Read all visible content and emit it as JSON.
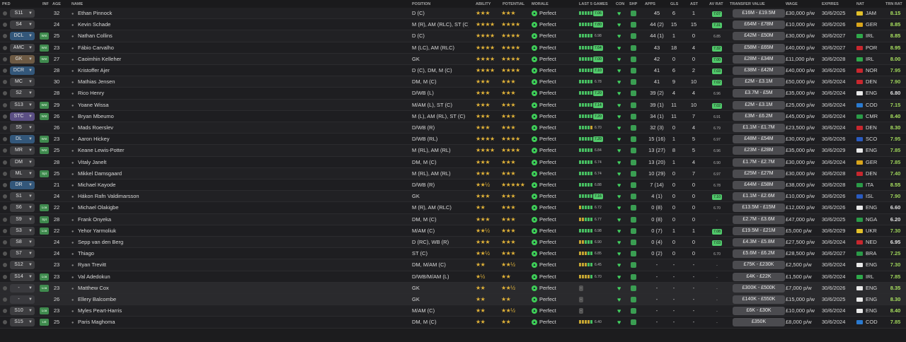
{
  "headers": {
    "pkd": "PKD",
    "inf": "INF",
    "age": "AGE",
    "name": "NAME",
    "position": "POSITION",
    "ability": "ABILITY",
    "potential": "POTENTIAL",
    "morale": "MORALE",
    "last5": "LAST 5 GAMES",
    "con": "CON",
    "shp": "SHP",
    "apps": "APPS",
    "gls": "GLS",
    "ast": "AST",
    "avrat": "AV RAT",
    "tv": "TRANSFER VALUE",
    "wage": "WAGE",
    "expires": "EXPIRES",
    "nat": "NAT",
    "trnrat": "TRN RAT"
  },
  "colors": {
    "accent_green": "#50c86a",
    "star_gold": "#e2b338",
    "morale_green": "#3fcf56",
    "trn_hi": "#a8e05f",
    "trn_mid": "#9dd25a",
    "trn_low": "#e0e0e0"
  },
  "rows": [
    {
      "pos": "S11",
      "pos_style": "grey2",
      "inf": "",
      "age": "32",
      "name": "Ethan Pinnock",
      "position": "D (C)",
      "ability": "★★★",
      "potential": "★★★",
      "morale": "Perfect",
      "form": [
        1,
        1,
        1,
        1,
        1
      ],
      "form_rating": "7.06",
      "apps": "45",
      "gls": "6",
      "ast": "1",
      "avrat": "7.07",
      "tv": "£16M - £19.5M",
      "wage": "£30,000 p/w",
      "expires": "30/6/2025",
      "nat": "JAM",
      "nat_color": "#e2c02a",
      "trn": "8.15",
      "trn_color": "#a8e05f"
    },
    {
      "pos": "S4",
      "pos_style": "grey2",
      "inf": "",
      "age": "24",
      "name": "Kevin Schade",
      "position": "M (R), AM (RLC), ST (C)",
      "ability": "★★★★",
      "potential": "★★★★",
      "morale": "Perfect",
      "form": [
        1,
        1,
        1,
        1,
        1
      ],
      "form_rating": "7.80",
      "apps": "44 (2)",
      "gls": "15",
      "ast": "15",
      "avrat": "7.31",
      "tv": "£64M - £78M",
      "wage": "£10,000 p/w",
      "expires": "30/6/2026",
      "nat": "GER",
      "nat_color": "#d9a51b",
      "trn": "8.85",
      "trn_color": "#a8e05f"
    },
    {
      "pos": "DCL",
      "pos_style": "blue",
      "inf": "Wnt",
      "age": "25",
      "name": "Nathan Collins",
      "position": "D (C)",
      "ability": "★★★★",
      "potential": "★★★★",
      "morale": "Perfect",
      "form": [
        1,
        1,
        1,
        1,
        1
      ],
      "form_rating": "6.98",
      "apps": "44 (1)",
      "gls": "1",
      "ast": "0",
      "avrat": "6.85",
      "tv": "£42M - £50M",
      "wage": "£30,000 p/w",
      "expires": "30/6/2027",
      "nat": "IRL",
      "nat_color": "#2fa84a",
      "trn": "8.85",
      "trn_color": "#a8e05f"
    },
    {
      "pos": "AMC",
      "pos_style": "grey2",
      "inf": "Wnt",
      "age": "23",
      "name": "Fábio Carvalho",
      "position": "M (LC), AM (RLC)",
      "ability": "★★★★",
      "potential": "★★★★",
      "morale": "Perfect",
      "form": [
        1,
        1,
        1,
        1,
        1
      ],
      "form_rating": "7.64",
      "apps": "43",
      "gls": "18",
      "ast": "4",
      "avrat": "7.32",
      "tv": "£58M - £65M",
      "wage": "£40,000 p/w",
      "expires": "30/6/2027",
      "nat": "POR",
      "nat_color": "#c8272e",
      "trn": "8.95",
      "trn_color": "#a8e05f"
    },
    {
      "pos": "GK",
      "pos_style": "brown",
      "inf": "Wnt",
      "age": "27",
      "name": "Caoimhin Kelleher",
      "position": "GK",
      "ability": "★★★★",
      "potential": "★★★★",
      "morale": "Perfect",
      "form": [
        1,
        1,
        1,
        1,
        1
      ],
      "form_rating": "7.00",
      "apps": "42",
      "gls": "0",
      "ast": "0",
      "avrat": "7.00",
      "tv": "£28M - £34M",
      "wage": "£11,000 p/w",
      "expires": "30/6/2028",
      "nat": "IRL",
      "nat_color": "#2fa84a",
      "trn": "8.00",
      "trn_color": "#a8e05f"
    },
    {
      "pos": "DCR",
      "pos_style": "blue",
      "inf": "",
      "age": "28",
      "name": "Kristoffer Ajer",
      "position": "D (C), DM, M (C)",
      "ability": "★★★★",
      "potential": "★★★★",
      "morale": "Perfect",
      "form": [
        1,
        1,
        1,
        1,
        1
      ],
      "form_rating": "7.10",
      "apps": "41",
      "gls": "6",
      "ast": "2",
      "avrat": "7.03",
      "tv": "£38M - £42M",
      "wage": "£40,000 p/w",
      "expires": "30/6/2026",
      "nat": "NOR",
      "nat_color": "#c8272e",
      "trn": "7.95",
      "trn_color": "#9dd25a"
    },
    {
      "pos": "MC",
      "pos_style": "grey2",
      "inf": "",
      "age": "30",
      "name": "Mathias Jensen",
      "position": "DM, M (C)",
      "ability": "★★★",
      "potential": "★★★",
      "morale": "Perfect",
      "form": [
        1,
        1,
        1,
        1,
        1
      ],
      "form_rating": "6.78",
      "apps": "41",
      "gls": "9",
      "ast": "10",
      "avrat": "7.02",
      "tv": "£2M - £3.1M",
      "wage": "£50,000 p/w",
      "expires": "30/6/2024",
      "nat": "DEN",
      "nat_color": "#c8272e",
      "trn": "7.90",
      "trn_color": "#9dd25a"
    },
    {
      "pos": "S2",
      "pos_style": "grey2",
      "inf": "",
      "age": "28",
      "name": "Rico Henry",
      "position": "D/WB (L)",
      "ability": "★★★",
      "potential": "★★★",
      "morale": "Perfect",
      "form": [
        1,
        1,
        1,
        1,
        1
      ],
      "form_rating": "7.20",
      "apps": "39 (2)",
      "gls": "4",
      "ast": "4",
      "avrat": "6.96",
      "tv": "£3.7M - £5M",
      "wage": "£35,000 p/w",
      "expires": "30/6/2024",
      "nat": "ENG",
      "nat_color": "#e8e8e8",
      "trn": "6.80",
      "trn_color": "#e0e0e0"
    },
    {
      "pos": "S13",
      "pos_style": "grey2",
      "inf": "Wnt",
      "age": "29",
      "name": "Yoane Wissa",
      "position": "M/AM (L), ST (C)",
      "ability": "★★★",
      "potential": "★★★",
      "morale": "Perfect",
      "form": [
        1,
        1,
        1,
        1,
        1
      ],
      "form_rating": "7.14",
      "apps": "39 (1)",
      "gls": "11",
      "ast": "10",
      "avrat": "7.02",
      "tv": "£2M - £3.1M",
      "wage": "£25,000 p/w",
      "expires": "30/6/2024",
      "nat": "COD",
      "nat_color": "#2a7ad0",
      "trn": "7.15",
      "trn_color": "#9dd25a"
    },
    {
      "pos": "STC",
      "pos_style": "purple",
      "inf": "Wnt",
      "age": "26",
      "name": "Bryan Mbeumo",
      "position": "M (L), AM (RL), ST (C)",
      "ability": "★★★",
      "potential": "★★★",
      "morale": "Perfect",
      "form": [
        1,
        1,
        1,
        1,
        1
      ],
      "form_rating": "7.20",
      "apps": "34 (1)",
      "gls": "11",
      "ast": "7",
      "avrat": "6.91",
      "tv": "£3M - £6.2M",
      "wage": "£45,000 p/w",
      "expires": "30/6/2024",
      "nat": "CMR",
      "nat_color": "#2a9a47",
      "trn": "8.40",
      "trn_color": "#a8e05f"
    },
    {
      "pos": "S5",
      "pos_style": "grey2",
      "inf": "",
      "age": "26",
      "name": "Mads Roerslev",
      "position": "D/WB (R)",
      "ability": "★★★",
      "potential": "★★★",
      "morale": "Perfect",
      "form": [
        1,
        1,
        1,
        1,
        0
      ],
      "form_rating": "6.70",
      "apps": "32 (3)",
      "gls": "0",
      "ast": "4",
      "avrat": "6.79",
      "tv": "£1.1M - £1.7M",
      "wage": "£23,500 p/w",
      "expires": "30/6/2024",
      "nat": "DEN",
      "nat_color": "#c8272e",
      "trn": "8.30",
      "trn_color": "#a8e05f"
    },
    {
      "pos": "DL",
      "pos_style": "blue",
      "inf": "Wnt",
      "age": "23",
      "name": "Aaron Hickey",
      "position": "D/WB (RL)",
      "ability": "★★★★",
      "potential": "★★★★",
      "morale": "Perfect",
      "form": [
        1,
        1,
        1,
        1,
        1
      ],
      "form_rating": "7.20",
      "apps": "15 (16)",
      "gls": "1",
      "ast": "5",
      "avrat": "6.97",
      "tv": "£48M - £54M",
      "wage": "£30,000 p/w",
      "expires": "30/6/2026",
      "nat": "SCO",
      "nat_color": "#2a5bc0",
      "trn": "7.95",
      "trn_color": "#9dd25a"
    },
    {
      "pos": "MR",
      "pos_style": "grey2",
      "inf": "Wnt",
      "age": "25",
      "name": "Keane Lewis-Potter",
      "position": "M (RL), AM (RL)",
      "ability": "★★★★",
      "potential": "★★★★",
      "morale": "Perfect",
      "form": [
        1,
        1,
        1,
        1,
        1
      ],
      "form_rating": "6.84",
      "apps": "13 (27)",
      "gls": "8",
      "ast": "5",
      "avrat": "6.96",
      "tv": "£23M - £28M",
      "wage": "£35,000 p/w",
      "expires": "30/6/2029",
      "nat": "ENG",
      "nat_color": "#e8e8e8",
      "trn": "7.85",
      "trn_color": "#9dd25a"
    },
    {
      "pos": "DM",
      "pos_style": "grey2",
      "inf": "",
      "age": "28",
      "name": "Vitaly Janelt",
      "position": "DM, M (C)",
      "ability": "★★★",
      "potential": "★★★",
      "morale": "Perfect",
      "form": [
        1,
        1,
        1,
        1,
        1
      ],
      "form_rating": "6.74",
      "apps": "13 (20)",
      "gls": "1",
      "ast": "4",
      "avrat": "6.90",
      "tv": "£1.7M - £2.7M",
      "wage": "£30,000 p/w",
      "expires": "30/6/2024",
      "nat": "GER",
      "nat_color": "#d9a51b",
      "trn": "7.85",
      "trn_color": "#9dd25a"
    },
    {
      "pos": "ML",
      "pos_style": "grey2",
      "inf": "Spt",
      "age": "25",
      "name": "Mikkel Damsgaard",
      "position": "M (RL), AM (RL)",
      "ability": "★★★",
      "potential": "★★★",
      "morale": "Perfect",
      "form": [
        1,
        1,
        1,
        1,
        1
      ],
      "form_rating": "6.74",
      "apps": "10 (29)",
      "gls": "0",
      "ast": "7",
      "avrat": "6.97",
      "tv": "£25M - £27M",
      "wage": "£30,000 p/w",
      "expires": "30/6/2028",
      "nat": "DEN",
      "nat_color": "#c8272e",
      "trn": "7.40",
      "trn_color": "#9dd25a"
    },
    {
      "pos": "DR",
      "pos_style": "blue",
      "inf": "",
      "age": "21",
      "name": "Michael Kayode",
      "position": "D/WB (R)",
      "ability": "★★½",
      "potential": "★★★★★",
      "morale": "Perfect",
      "form": [
        1,
        1,
        1,
        1,
        1
      ],
      "form_rating": "6.88",
      "apps": "7 (14)",
      "gls": "0",
      "ast": "0",
      "avrat": "6.78",
      "tv": "£44M - £58M",
      "wage": "£38,000 p/w",
      "expires": "30/6/2028",
      "nat": "ITA",
      "nat_color": "#2a9a47",
      "trn": "8.55",
      "trn_color": "#a8e05f"
    },
    {
      "pos": "S1",
      "pos_style": "grey2",
      "inf": "",
      "age": "24",
      "name": "Hákon Rafn Valdimarsson",
      "position": "GK",
      "ability": "★★★",
      "potential": "★★★",
      "morale": "Perfect",
      "form": [
        1,
        1,
        1,
        1,
        1
      ],
      "form_rating": "7.16",
      "apps": "4 (1)",
      "gls": "0",
      "ast": "0",
      "avrat": "7.10",
      "tv": "£1.1M - £2.6M",
      "wage": "£10,000 p/w",
      "expires": "30/6/2026",
      "nat": "ISL",
      "nat_color": "#2a5bc0",
      "trn": "7.90",
      "trn_color": "#9dd25a"
    },
    {
      "pos": "S6",
      "pos_style": "grey2",
      "inf": "Loa",
      "age": "22",
      "name": "Michael Olakigbe",
      "position": "M (R), AM (RLC)",
      "ability": "★★",
      "potential": "★★★",
      "morale": "Perfect",
      "form": [
        0,
        1,
        1,
        1,
        1
      ],
      "form_rating": "6.72",
      "apps": "0 (8)",
      "gls": "0",
      "ast": "0",
      "avrat": "6.70",
      "tv": "£13.5M - £15M",
      "wage": "£12,000 p/w",
      "expires": "30/6/2026",
      "nat": "ENG",
      "nat_color": "#e8e8e8",
      "trn": "6.60",
      "trn_color": "#e0e0e0"
    },
    {
      "pos": "S9",
      "pos_style": "grey2",
      "inf": "Spt",
      "age": "28",
      "name": "Frank Onyeka",
      "position": "DM, M (C)",
      "ability": "★★★",
      "potential": "★★★",
      "morale": "Perfect",
      "form": [
        0,
        0,
        1,
        1,
        1
      ],
      "form_rating": "6.77",
      "apps": "0 (8)",
      "gls": "0",
      "ast": "0",
      "avrat": "-",
      "tv": "£2.7M - £3.6M",
      "wage": "£47,000 p/w",
      "expires": "30/6/2025",
      "nat": "NGA",
      "nat_color": "#2a9a47",
      "trn": "6.20",
      "trn_color": "#e0e0e0"
    },
    {
      "pos": "S3",
      "pos_style": "grey2",
      "inf": "Loa",
      "age": "22",
      "name": "Yehor Yarmoliuk",
      "position": "M/AM (C)",
      "ability": "★★½",
      "potential": "★★★",
      "morale": "Perfect",
      "form": [
        1,
        1,
        1,
        1,
        1
      ],
      "form_rating": "6.98",
      "apps": "0 (7)",
      "gls": "1",
      "ast": "1",
      "avrat": "7.08",
      "tv": "£19.5M - £21M",
      "wage": "£5,000 p/w",
      "expires": "30/6/2029",
      "nat": "UKR",
      "nat_color": "#e2c02a",
      "trn": "7.30",
      "trn_color": "#9dd25a"
    },
    {
      "pos": "S8",
      "pos_style": "grey2",
      "inf": "",
      "age": "24",
      "name": "Sepp van den Berg",
      "position": "D (RC), WB (R)",
      "ability": "★★★",
      "potential": "★★★",
      "morale": "Perfect",
      "form": [
        0,
        0,
        1,
        1,
        1
      ],
      "form_rating": "6.90",
      "apps": "0 (4)",
      "gls": "0",
      "ast": "0",
      "avrat": "7.03",
      "tv": "£4.3M - £5.8M",
      "wage": "£27,500 p/w",
      "expires": "30/6/2024",
      "nat": "NED",
      "nat_color": "#c8272e",
      "trn": "6.95",
      "trn_color": "#e0e0e0"
    },
    {
      "pos": "S7",
      "pos_style": "grey2",
      "inf": "",
      "age": "24",
      "name": "Thiago",
      "position": "ST (C)",
      "ability": "★★½",
      "potential": "★★★",
      "morale": "Perfect",
      "form": [
        0,
        0,
        0,
        1,
        1
      ],
      "form_rating": "6.85",
      "apps": "0 (2)",
      "gls": "0",
      "ast": "0",
      "avrat": "6.70",
      "tv": "£5.6M - £6.2M",
      "wage": "£28,500 p/w",
      "expires": "30/6/2027",
      "nat": "BRA",
      "nat_color": "#2a9a47",
      "trn": "7.25",
      "trn_color": "#9dd25a"
    },
    {
      "pos": "S12",
      "pos_style": "grey2",
      "inf": "",
      "age": "23",
      "name": "Ryan Trevitt",
      "position": "DM, M/AM (C)",
      "ability": "★★",
      "potential": "★★½",
      "morale": "Perfect",
      "form": [
        0,
        0,
        0,
        1,
        1
      ],
      "form_rating": "6.45",
      "apps": "-",
      "gls": "-",
      "ast": "-",
      "avrat": "-",
      "tv": "£75K - £230K",
      "wage": "£2,500 p/w",
      "expires": "30/6/2024",
      "nat": "ENG",
      "nat_color": "#e8e8e8",
      "trn": "7.30",
      "trn_color": "#9dd25a"
    },
    {
      "pos": "S14",
      "pos_style": "grey2",
      "inf": "Loa",
      "age": "23",
      "name": "Val Adedokun",
      "position": "D/WB/M/AM (L)",
      "ability": "★½",
      "potential": "★★",
      "morale": "Perfect",
      "form": [
        0,
        0,
        0,
        0,
        1
      ],
      "form_rating": "6.70",
      "apps": "-",
      "gls": "-",
      "ast": "-",
      "avrat": "-",
      "tv": "£4K - £22K",
      "wage": "£1,500 p/w",
      "expires": "30/6/2024",
      "nat": "IRL",
      "nat_color": "#2fa84a",
      "trn": "7.85",
      "trn_color": "#9dd25a"
    },
    {
      "pos": "-",
      "pos_style": "none",
      "inf": "Loa",
      "age": "23",
      "name": "Matthew Cox",
      "position": "GK",
      "ability": "★★",
      "potential": "★★½",
      "morale": "Perfect",
      "form": [],
      "form_rating": "-",
      "apps": "-",
      "gls": "-",
      "ast": "-",
      "avrat": "-",
      "tv": "£300K - £500K",
      "wage": "£7,000 p/w",
      "expires": "30/6/2026",
      "nat": "ENG",
      "nat_color": "#e8e8e8",
      "trn": "8.35",
      "trn_color": "#a8e05f"
    },
    {
      "pos": "-",
      "pos_style": "none",
      "inf": "",
      "age": "26",
      "name": "Ellery Balcombe",
      "position": "GK",
      "ability": "★★",
      "potential": "★★",
      "morale": "Perfect",
      "form": [],
      "form_rating": "-",
      "apps": "-",
      "gls": "-",
      "ast": "-",
      "avrat": "-",
      "tv": "£140K - £550K",
      "wage": "£15,000 p/w",
      "expires": "30/6/2025",
      "nat": "ENG",
      "nat_color": "#e8e8e8",
      "trn": "8.30",
      "trn_color": "#a8e05f"
    },
    {
      "pos": "S10",
      "pos_style": "grey2",
      "inf": "Loa",
      "age": "23",
      "name": "Myles Peart-Harris",
      "position": "M/AM (C)",
      "ability": "★★",
      "potential": "★★½",
      "morale": "Perfect",
      "form": [],
      "form_rating": "-",
      "apps": "-",
      "gls": "-",
      "ast": "-",
      "avrat": "-",
      "tv": "£6K - £30K",
      "wage": "£10,000 p/w",
      "expires": "30/6/2024",
      "nat": "ENG",
      "nat_color": "#e8e8e8",
      "trn": "8.40",
      "trn_color": "#a8e05f"
    },
    {
      "pos": "S15",
      "pos_style": "grey2",
      "inf": "Lst",
      "age": "25",
      "name": "Paris Maghoma",
      "position": "DM, M (C)",
      "ability": "★★",
      "potential": "★★",
      "morale": "Perfect",
      "form": [
        0,
        0,
        0,
        0,
        1
      ],
      "form_rating": "6.40",
      "apps": "-",
      "gls": "-",
      "ast": "-",
      "avrat": "-",
      "tv": "£350K",
      "wage": "£8,000 p/w",
      "expires": "30/6/2024",
      "nat": "COD",
      "nat_color": "#2a7ad0",
      "trn": "7.85",
      "trn_color": "#9dd25a"
    }
  ]
}
